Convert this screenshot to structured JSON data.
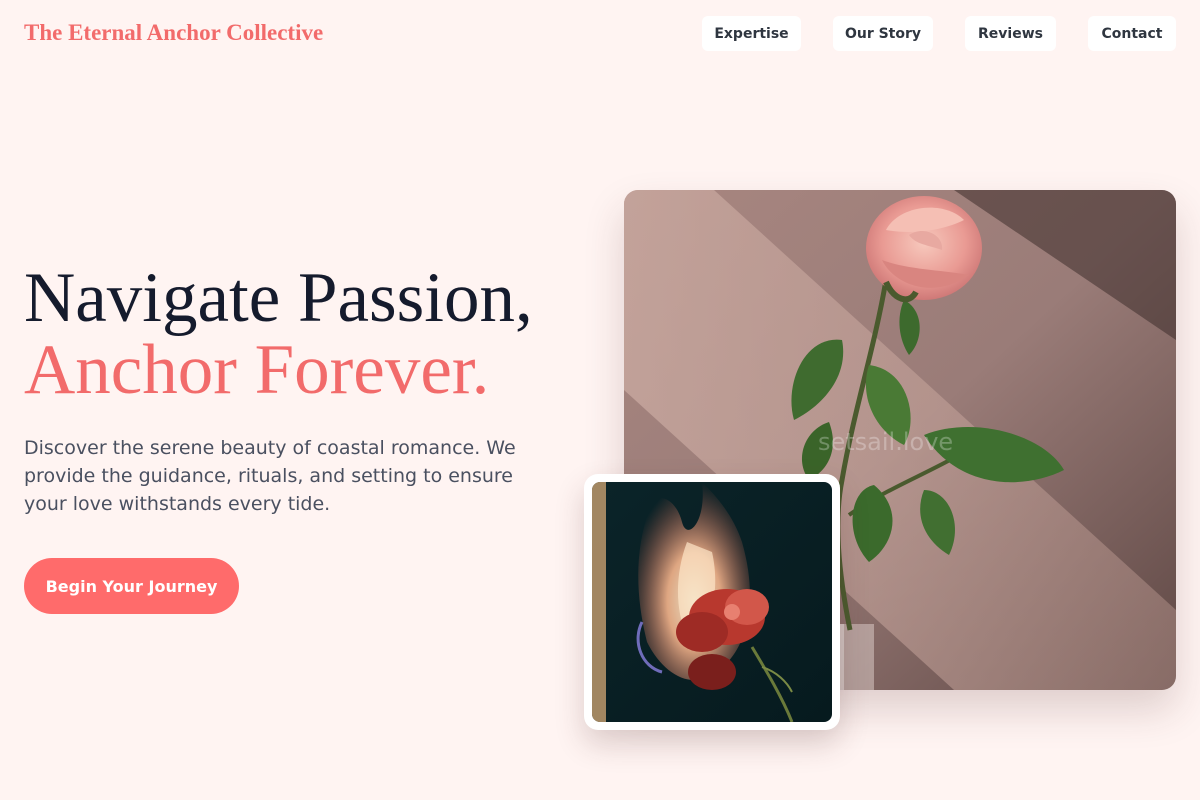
{
  "header": {
    "logo": "The Eternal Anchor Collective",
    "nav": [
      {
        "label": "Expertise"
      },
      {
        "label": "Our Story"
      },
      {
        "label": "Reviews"
      },
      {
        "label": "Contact"
      }
    ]
  },
  "hero": {
    "title_line1": "Navigate Passion,",
    "title_line2": "Anchor Forever.",
    "description": "Discover the serene beauty of coastal romance. We provide the guidance, rituals, and setting to ensure your love withstands every tide.",
    "cta_label": "Begin Your Journey"
  },
  "images": {
    "main_watermark": "setsail.love"
  },
  "colors": {
    "background": "#fff4f2",
    "accent": "#f26b6b",
    "button": "#ff6b6b",
    "heading": "#151b2d"
  }
}
